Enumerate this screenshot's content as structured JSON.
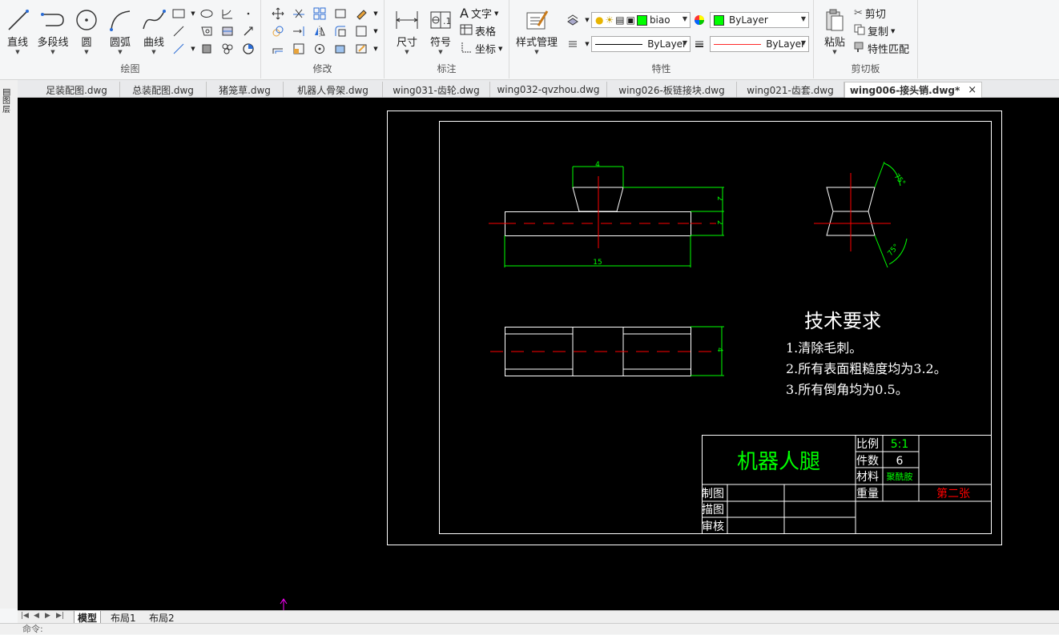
{
  "ribbon": {
    "draw": {
      "title": "绘图",
      "tools": [
        {
          "label": "直线",
          "icon": "line-icon"
        },
        {
          "label": "多段线",
          "icon": "polyline-icon"
        },
        {
          "label": "圆",
          "icon": "circle-icon"
        },
        {
          "label": "圆弧",
          "icon": "arc-icon"
        },
        {
          "label": "曲线",
          "icon": "spline-icon"
        }
      ]
    },
    "modify": {
      "title": "修改"
    },
    "annotation": {
      "title": "标注",
      "dimension_label": "尺寸",
      "symbol_label": "符号",
      "text_label": "文字",
      "table_label": "表格",
      "coord_label": "坐标"
    },
    "properties": {
      "title": "特性",
      "style_label": "样式管理",
      "layer_value": "biao",
      "color_value": "ByLayer",
      "linetype_value": "ByLayer",
      "lineweight_value": "ByLayer",
      "layer_color": "#00ff00",
      "lineweight_color": "#ff2a2a"
    },
    "clipboard": {
      "title": "剪切板",
      "paste_label": "粘贴",
      "cut_label": "剪切",
      "copy_label": "复制",
      "match_label": "特性匹配"
    }
  },
  "tabs": [
    {
      "label": "足装配图.dwg"
    },
    {
      "label": "总装配图.dwg"
    },
    {
      "label": "猪笼草.dwg"
    },
    {
      "label": "机器人骨架.dwg"
    },
    {
      "label": "wing031-齿轮.dwg"
    },
    {
      "label": "wing032-qvzhou.dwg"
    },
    {
      "label": "wing026-板链接块.dwg"
    },
    {
      "label": "wing021-齿套.dwg"
    },
    {
      "label": "wing006-接头销.dwg*",
      "active": true
    }
  ],
  "tab_close": "×",
  "left_toolbar_label": "图层",
  "drawing": {
    "dims": {
      "top_width": "4",
      "height_a": "2",
      "height_b": "2",
      "length": "15",
      "side_height": "4",
      "angle_a": "75°",
      "angle_b": "75°"
    },
    "notes_title": "技术要求",
    "notes": [
      "1.清除毛刺。",
      "2.所有表面粗糙度均为3.2。",
      "3.所有倒角均为0.5。"
    ],
    "title_block": {
      "part_name": "机器人腿",
      "scale_label": "比例",
      "scale_value": "5:1",
      "qty_label": "件数",
      "qty_value": "6",
      "material_label": "材料",
      "material_value": "聚酰胺",
      "weight_label": "重量",
      "sheet_text": "第二张",
      "drawn_label": "制图",
      "traced_label": "描图",
      "checked_label": "审核"
    },
    "colors": {
      "outline": "#ffffff",
      "dimension": "#00ff00",
      "centerline": "#ff0000",
      "crosshair": "#ff00ff"
    }
  },
  "layout_tabs": [
    {
      "label": "模型",
      "active": true
    },
    {
      "label": "布局1"
    },
    {
      "label": "布局2"
    }
  ],
  "command_prompt": "命令:"
}
